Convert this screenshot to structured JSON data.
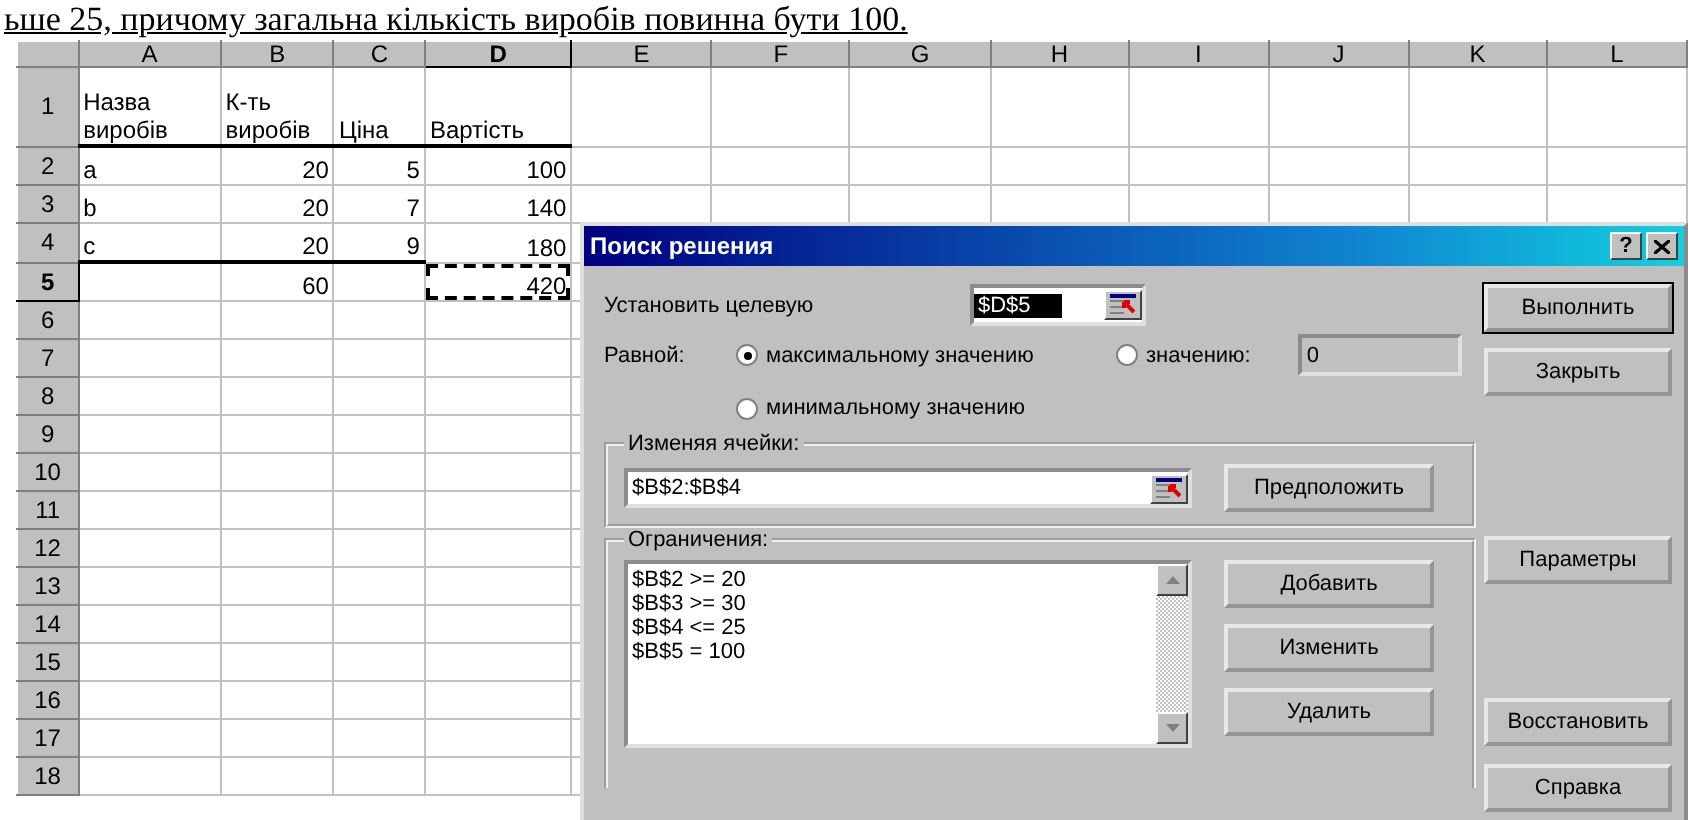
{
  "caption": "ьше 25, причому загальна кількість виробів повинна бути 100.",
  "sheet": {
    "columns": [
      {
        "label": "A",
        "selected": false
      },
      {
        "label": "B",
        "selected": false
      },
      {
        "label": "C",
        "selected": false
      },
      {
        "label": "D",
        "selected": true
      },
      {
        "label": "E",
        "selected": false
      },
      {
        "label": "F",
        "selected": false
      },
      {
        "label": "G",
        "selected": false
      },
      {
        "label": "H",
        "selected": false
      },
      {
        "label": "I",
        "selected": false
      },
      {
        "label": "J",
        "selected": false
      },
      {
        "label": "K",
        "selected": false
      },
      {
        "label": "L",
        "selected": false
      }
    ],
    "rows": [
      {
        "label": "1",
        "selected": false,
        "cells": [
          {
            "text": "Назва виробів",
            "thick_bottom": true
          },
          {
            "text": "К-ть виробів",
            "thick_bottom": true
          },
          {
            "text": "Ціна",
            "thick_bottom": true
          },
          {
            "text": "Вартість",
            "thick_bottom": true
          }
        ]
      },
      {
        "label": "2",
        "selected": false,
        "cells": [
          {
            "text": "a",
            "thick_bottom": false
          },
          {
            "text": "20",
            "thick_bottom": false
          },
          {
            "text": "5",
            "thick_bottom": false
          },
          {
            "text": "100",
            "thick_bottom": false
          }
        ]
      },
      {
        "label": "3",
        "selected": false,
        "cells": [
          {
            "text": "b",
            "thick_bottom": false
          },
          {
            "text": "20",
            "thick_bottom": false
          },
          {
            "text": "7",
            "thick_bottom": false
          },
          {
            "text": "140",
            "thick_bottom": false
          }
        ]
      },
      {
        "label": "4",
        "selected": false,
        "cells": [
          {
            "text": "c",
            "thick_bottom": true
          },
          {
            "text": "20",
            "thick_bottom": true
          },
          {
            "text": "9",
            "thick_bottom": true
          },
          {
            "text": "180",
            "thick_bottom": false
          }
        ]
      },
      {
        "label": "5",
        "selected": true,
        "cells": [
          {
            "text": ""
          },
          {
            "text": "60"
          },
          {
            "text": ""
          },
          {
            "text": "420",
            "marquee": true
          }
        ]
      },
      {
        "label": "6",
        "selected": false
      },
      {
        "label": "7",
        "selected": false
      },
      {
        "label": "8",
        "selected": false
      },
      {
        "label": "9",
        "selected": false
      },
      {
        "label": "10",
        "selected": false
      },
      {
        "label": "11",
        "selected": false
      },
      {
        "label": "12",
        "selected": false
      },
      {
        "label": "13",
        "selected": false
      },
      {
        "label": "14",
        "selected": false
      },
      {
        "label": "15",
        "selected": false
      },
      {
        "label": "16",
        "selected": false
      },
      {
        "label": "17",
        "selected": false
      },
      {
        "label": "18",
        "selected": false
      }
    ]
  },
  "dialog": {
    "title": "Поиск решения",
    "help_button": "?",
    "target": {
      "label": "Установить целевую",
      "value": "$D$5",
      "selected": true
    },
    "equal_label": "Равной:",
    "options": [
      {
        "label": "максимальному значению",
        "selected": true
      },
      {
        "label": "значению:",
        "selected": false
      },
      {
        "label": "минимальному значению",
        "selected": false
      }
    ],
    "value_field": {
      "value": "0",
      "disabled": true
    },
    "changing": {
      "legend": "Изменяя ячейки:",
      "value": "$B$2:$B$4",
      "button": "Предположить"
    },
    "constraints": {
      "legend": "Ограничения:",
      "items": [
        "$B$2 >= 20",
        "$B$3 >= 30",
        "$B$4 <= 25",
        "$B$5 = 100"
      ],
      "buttons": [
        "Добавить",
        "Изменить",
        "Удалить"
      ]
    },
    "buttons": [
      {
        "label": "Выполнить",
        "default": true
      },
      {
        "label": "Закрыть",
        "default": false
      },
      {
        "label": "Параметры",
        "default": false
      },
      {
        "label": "Восстановить",
        "default": false
      },
      {
        "label": "Справка",
        "default": false
      }
    ]
  }
}
